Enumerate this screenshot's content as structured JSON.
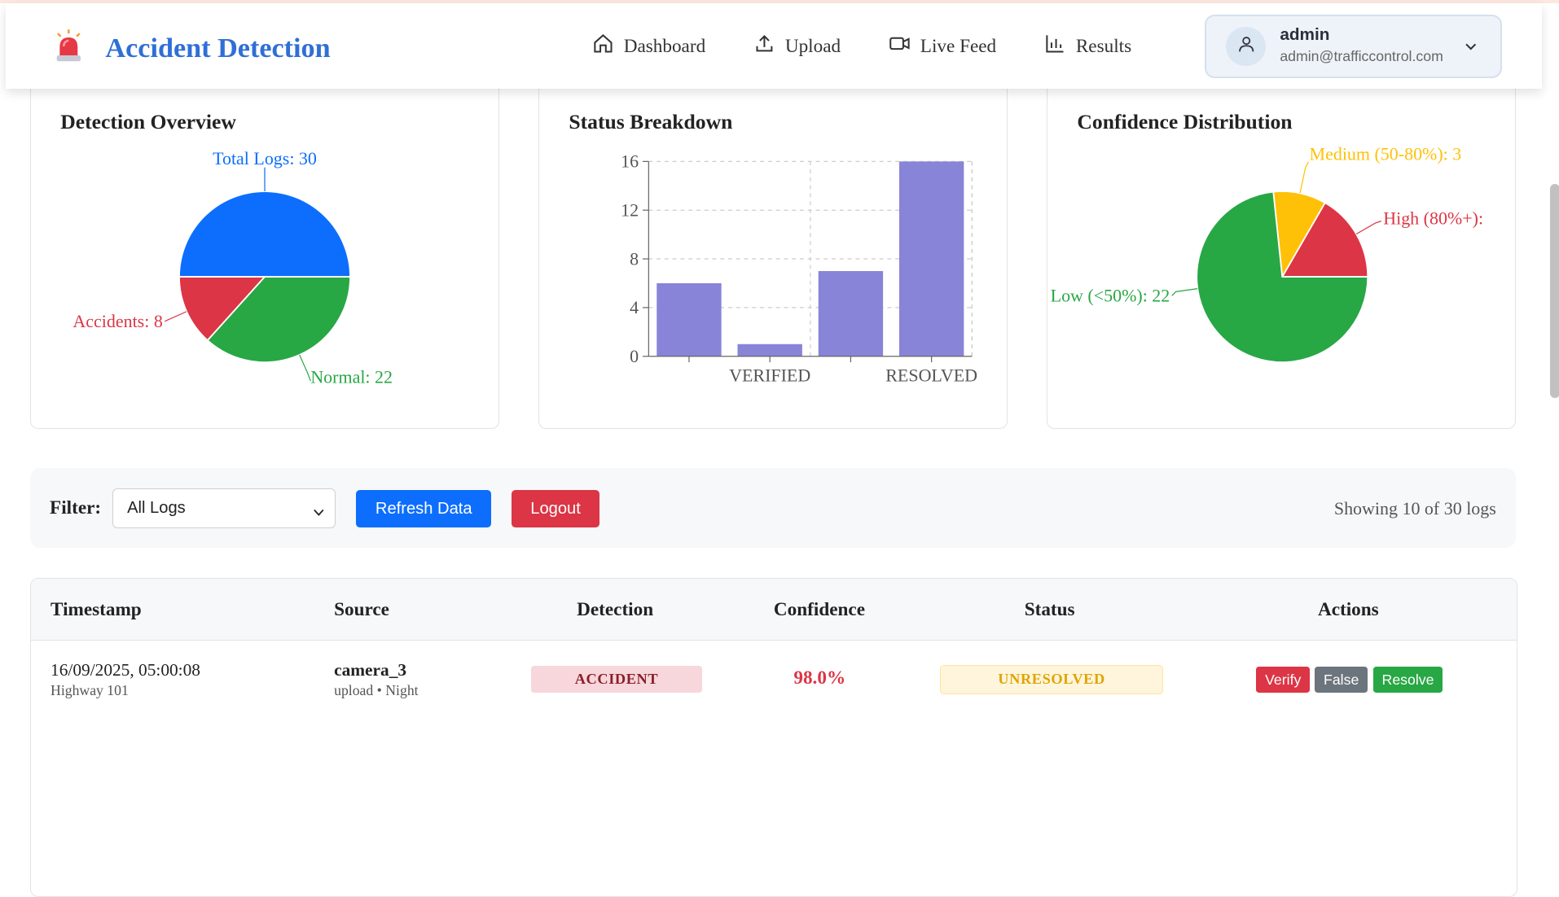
{
  "brand": {
    "title": "Accident Detection",
    "icon": "alarm-siren-icon"
  },
  "nav": [
    {
      "label": "Dashboard",
      "icon": "home-icon"
    },
    {
      "label": "Upload",
      "icon": "upload-icon"
    },
    {
      "label": "Live Feed",
      "icon": "video-icon"
    },
    {
      "label": "Results",
      "icon": "bar-chart-icon"
    }
  ],
  "user": {
    "name": "admin",
    "email": "admin@trafficcontrol.com"
  },
  "cards": {
    "overview_title": "Detection Overview",
    "status_title": "Status Breakdown",
    "confidence_title": "Confidence Distribution"
  },
  "chart_data": [
    {
      "type": "pie",
      "title": "Detection Overview",
      "labels": [
        "Total Logs: 30",
        "Normal: 22",
        "Accidents: 8"
      ],
      "values": [
        30,
        22,
        8
      ],
      "colors": [
        "#0d6efd",
        "#28a745",
        "#dc3545"
      ]
    },
    {
      "type": "bar",
      "title": "Status Breakdown",
      "categories": [
        "",
        "VERIFIED",
        "",
        "RESOLVED"
      ],
      "values": [
        6,
        1,
        7,
        16
      ],
      "ylim": [
        0,
        16
      ],
      "yticks": [
        0,
        4,
        8,
        12,
        16
      ],
      "color": "#8884d8",
      "grid": true
    },
    {
      "type": "pie",
      "title": "Confidence Distribution",
      "labels": [
        "High (80%+):",
        "Medium (50-80%): 3",
        "Low (<50%): 22"
      ],
      "values": [
        5,
        3,
        22
      ],
      "colors": [
        "#dc3545",
        "#ffc107",
        "#28a745"
      ]
    }
  ],
  "filter": {
    "label": "Filter:",
    "selected": "All Logs",
    "refresh_label": "Refresh Data",
    "logout_label": "Logout",
    "showing": "Showing 10 of 30 logs"
  },
  "table": {
    "headers": [
      "Timestamp",
      "Source",
      "Detection",
      "Confidence",
      "Status",
      "Actions"
    ],
    "rows": [
      {
        "timestamp": "16/09/2025, 05:00:08",
        "location": "Highway 101",
        "source": "camera_3",
        "source_sub": "upload • Night",
        "detection": "ACCIDENT",
        "confidence": "98.0%",
        "status": "UNRESOLVED",
        "actions": [
          "Verify",
          "False",
          "Resolve"
        ]
      }
    ]
  }
}
